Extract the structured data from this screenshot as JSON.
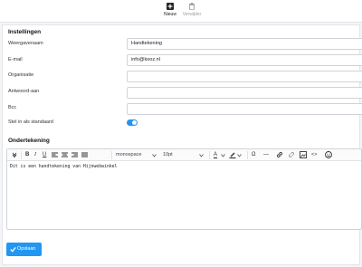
{
  "toolbar": {
    "new_label": "Nieuw",
    "delete_label": "Verwijder"
  },
  "settings": {
    "heading": "Instellingen",
    "fields": {
      "sender_name": {
        "label": "Weergavenaam",
        "value": "Handtekening"
      },
      "email": {
        "label": "E-mail",
        "value": "info@kooz.nl"
      },
      "organization": {
        "label": "Organisatie",
        "value": ""
      },
      "reply_to": {
        "label": "Antwoord-aan",
        "value": ""
      },
      "bcc": {
        "label": "Bcc",
        "value": ""
      }
    },
    "default": {
      "label": "Stel in als standaard",
      "checked": true
    }
  },
  "signature": {
    "heading": "Ondertekening",
    "font_family": "monospace",
    "font_size": "10pt",
    "content": "Dit is een handtekening van Hijnwebwinkel"
  },
  "actions": {
    "save_label": "Opslaan"
  },
  "colors": {
    "accent": "#2196f3",
    "text": "#222222"
  }
}
